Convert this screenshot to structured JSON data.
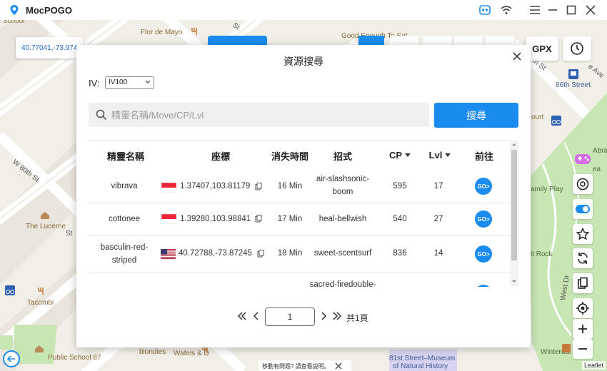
{
  "app": {
    "title": "MocPOGO"
  },
  "map": {
    "coordinate_text": "40.77041,-73.974",
    "labels": {
      "flor_de_mayo": "Flor de Mayo",
      "good_enough": "Good Enough To Eat",
      "w_80th_st": "W 80th St",
      "the_lucerne": "The Lucerne",
      "tacombi": "Tacombi",
      "public_school": "Public School 87",
      "blondies": "blondies",
      "wafels": "Wafels & D",
      "museum_line1": "81st Street–Museum",
      "museum_line2": "of Natural History",
      "street_86th": "86th Street",
      "family_play": "amily Play",
      "it_rock": "it Rock",
      "west_dr": "West Dr",
      "winterdal": "Winterdal",
      "st_a": "St",
      "st_b": "St",
      "th_st": "th St",
      "ourt": "ourt",
      "abra": "Abra",
      "ea": "ea",
      "school_top": "School",
      "ave": "e Ave"
    },
    "gpx_label": "GPX",
    "leaflet_attribution": "Leaflet",
    "bottom_banner": "移動有問題? 請查看說明。"
  },
  "modal": {
    "title": "資源搜尋",
    "iv_label": "IV:",
    "iv_value": "IV100",
    "search_placeholder": "精靈名稱/Move/CP/Lvl",
    "search_button": "搜尋",
    "columns": {
      "name": "精靈名稱",
      "coords": "座標",
      "expire": "消失時間",
      "moves": "招式",
      "cp": "CP",
      "lvl": "Lvl",
      "go": "前往"
    },
    "go_label": "GO>",
    "rows": [
      {
        "name": "vibrava",
        "flag": "sg",
        "coords": "1.37407,103.81179",
        "expire": "16 Min",
        "moves": "air-slashsonic-boom",
        "cp": "595",
        "lvl": "17"
      },
      {
        "name": "cottonee",
        "flag": "sg",
        "coords": "1.39280,103.98841",
        "expire": "17 Min",
        "moves": "heal-bellwish",
        "cp": "540",
        "lvl": "27"
      },
      {
        "name": "basculin-red-striped",
        "flag": "us",
        "coords": "40.72788,-73.87245",
        "expire": "18 Min",
        "moves": "sweet-scentsurf",
        "cp": "836",
        "lvl": "14"
      },
      {
        "name": "",
        "flag": "us",
        "coords": "",
        "expire": "",
        "moves": "sacred-firedouble-",
        "cp": "",
        "lvl": ""
      }
    ],
    "pagination": {
      "current_page": "1",
      "total_text": "共1頁"
    }
  },
  "colors": {
    "accent": "#1a8cf0",
    "map_bg": "#f2efe9",
    "park": "#c8e6b4"
  }
}
